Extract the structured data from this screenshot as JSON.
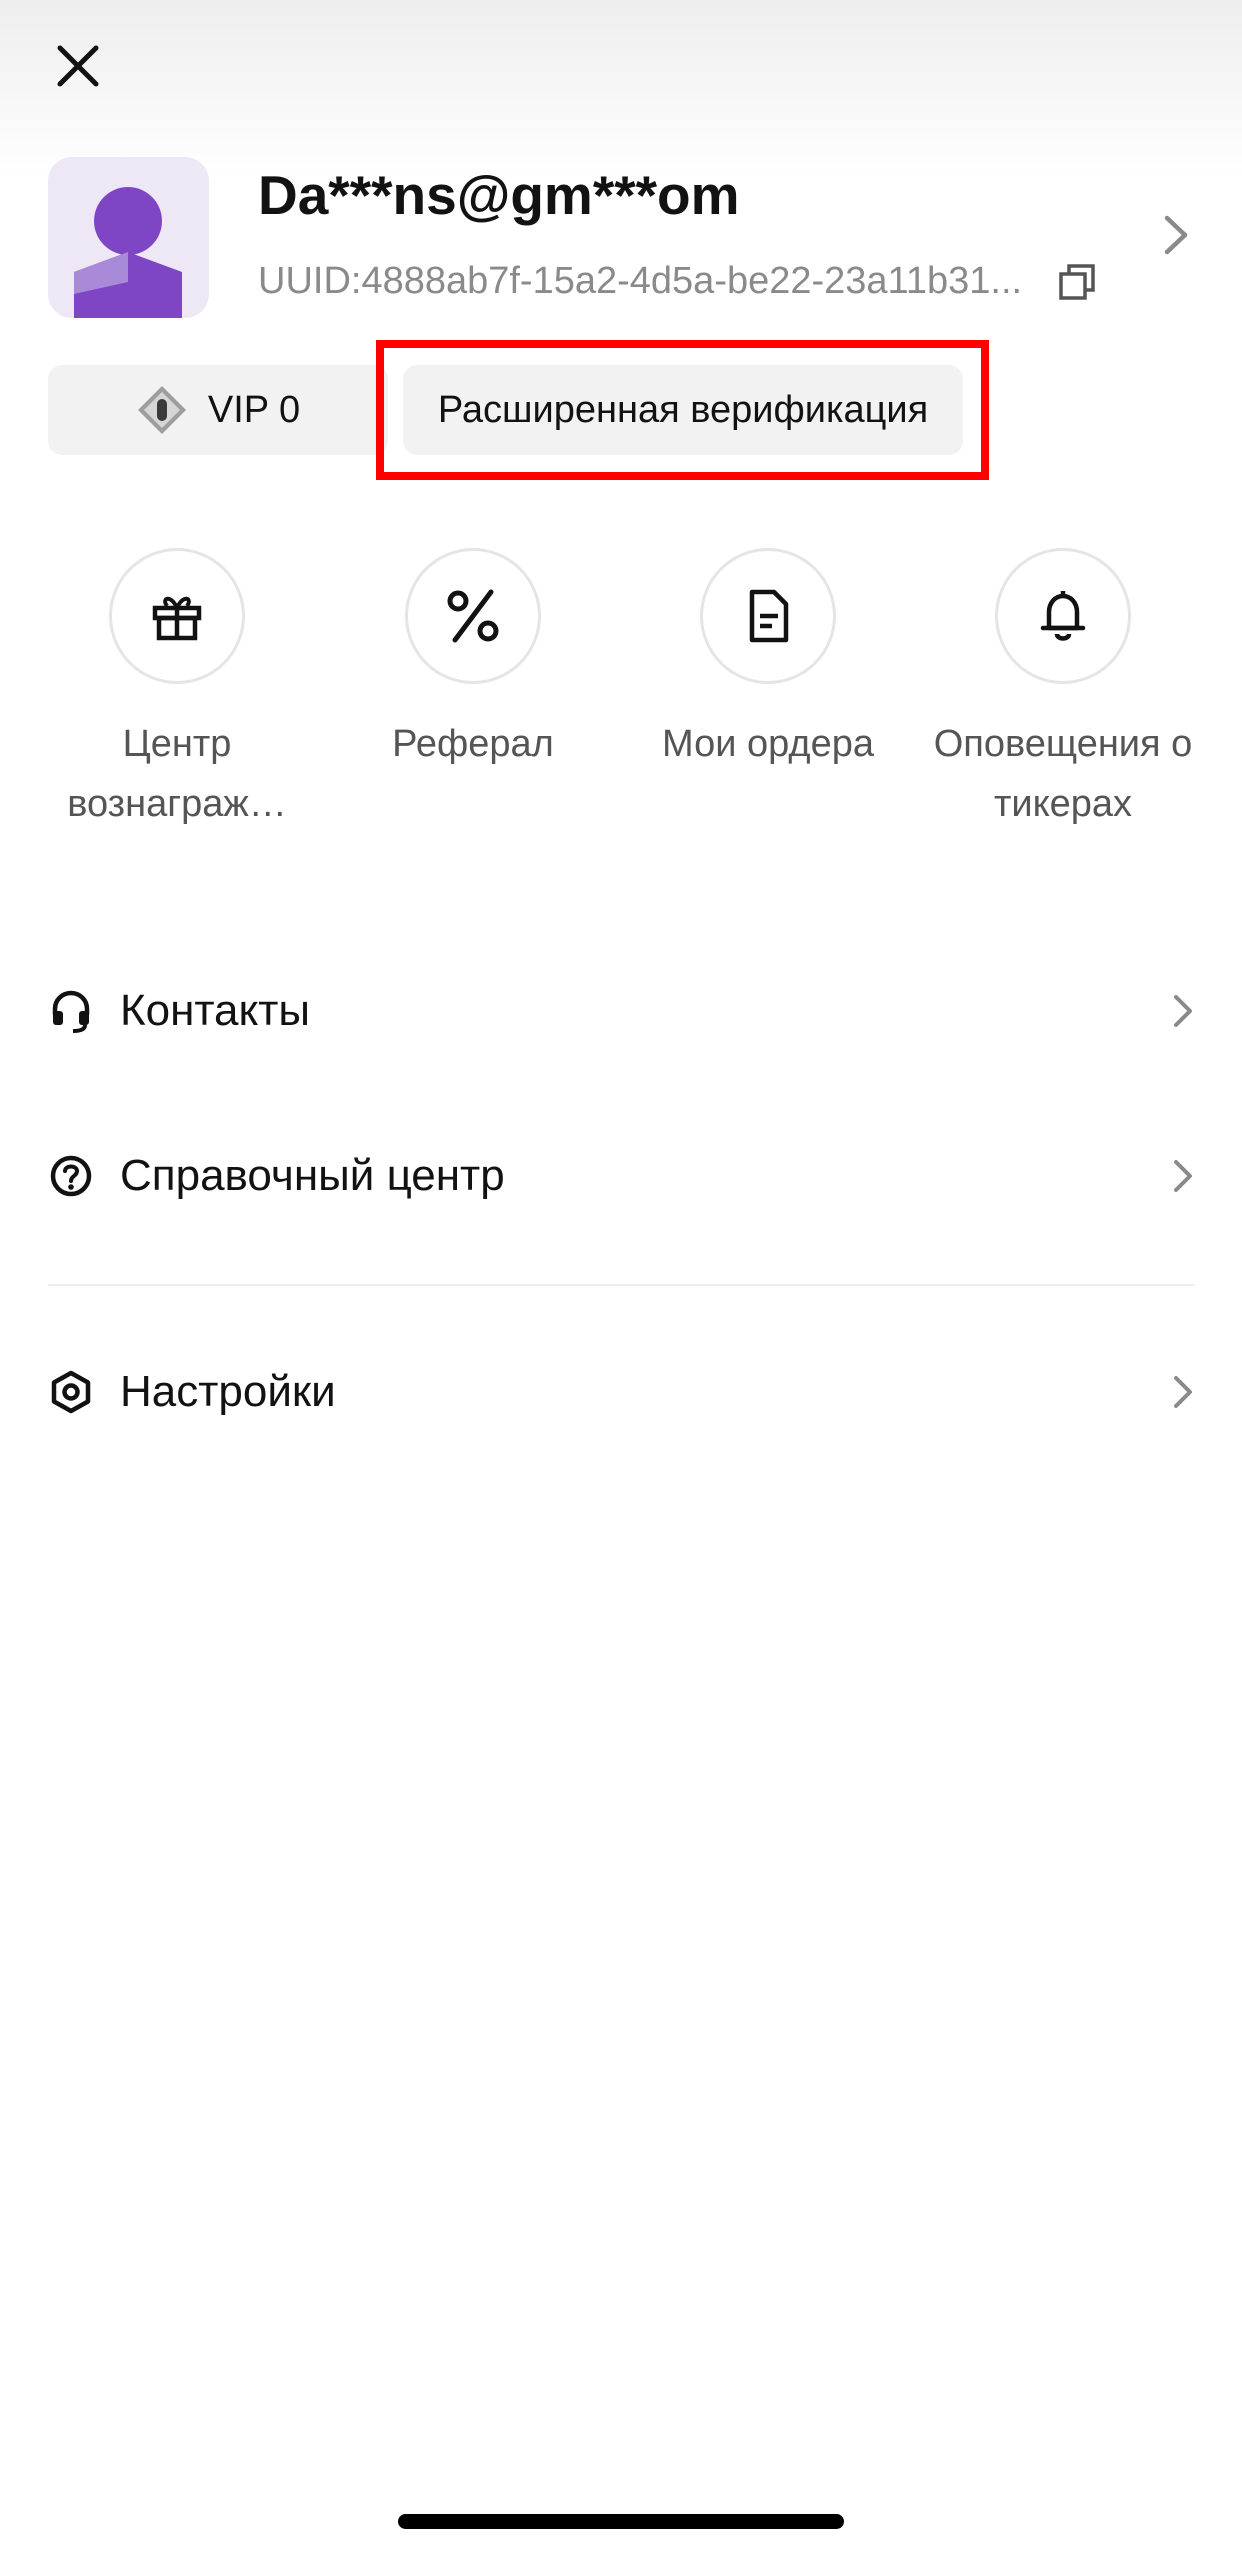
{
  "header": {
    "close_icon": "close-icon"
  },
  "profile": {
    "username": "Da***ns@gm***om",
    "uuid": "UUID:4888ab7f-15a2-4d5a-be22-23a11b31...",
    "avatar_color": "#7E46C4",
    "avatar_bg": "#EDE7F6"
  },
  "badges": {
    "vip_label": "VIP 0",
    "verification_label": "Расширенная верификация",
    "highlight_color": "#FF0000"
  },
  "quick_actions": [
    {
      "label": "Центр вознаграж…",
      "icon": "gift-icon"
    },
    {
      "label": "Реферал",
      "icon": "percent-icon"
    },
    {
      "label": "Мои ордера",
      "icon": "document-icon"
    },
    {
      "label": "Оповещения о тикерах",
      "icon": "bell-icon"
    }
  ],
  "menu": [
    {
      "label": "Контакты",
      "icon": "headset-icon"
    },
    {
      "label": "Справочный центр",
      "icon": "help-circle-icon"
    },
    {
      "label": "Настройки",
      "icon": "settings-hexagon-icon"
    }
  ]
}
